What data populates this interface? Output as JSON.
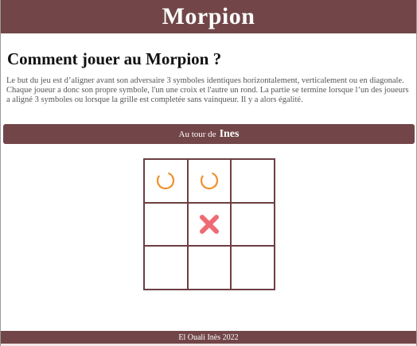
{
  "header": {
    "title": "Morpion"
  },
  "rules": {
    "title": "Comment jouer au Morpion ?",
    "line1": "Le but du jeu est d’aligner avant son adversaire 3 symboles identiques horizontalement, verticalement ou en diagonale.",
    "line2": "Chaque joueur a donc son propre symbole, l'un une croix et l'autre un rond. La partie se termine lorsque l’un des joueurs a aligné 3 symboles ou lorsque la grille est completée sans vainqueur. Il y a alors égalité."
  },
  "turn": {
    "prefix": "Au tour de",
    "player": "Ines"
  },
  "board": {
    "cells": [
      "O",
      "O",
      "",
      "",
      "X",
      "",
      "",
      "",
      ""
    ]
  },
  "colors": {
    "brand": "#724648",
    "o_mark": "#f0902a",
    "x_mark": "#ee6b73"
  },
  "footer": {
    "text": "El Ouali Inès 2022"
  }
}
